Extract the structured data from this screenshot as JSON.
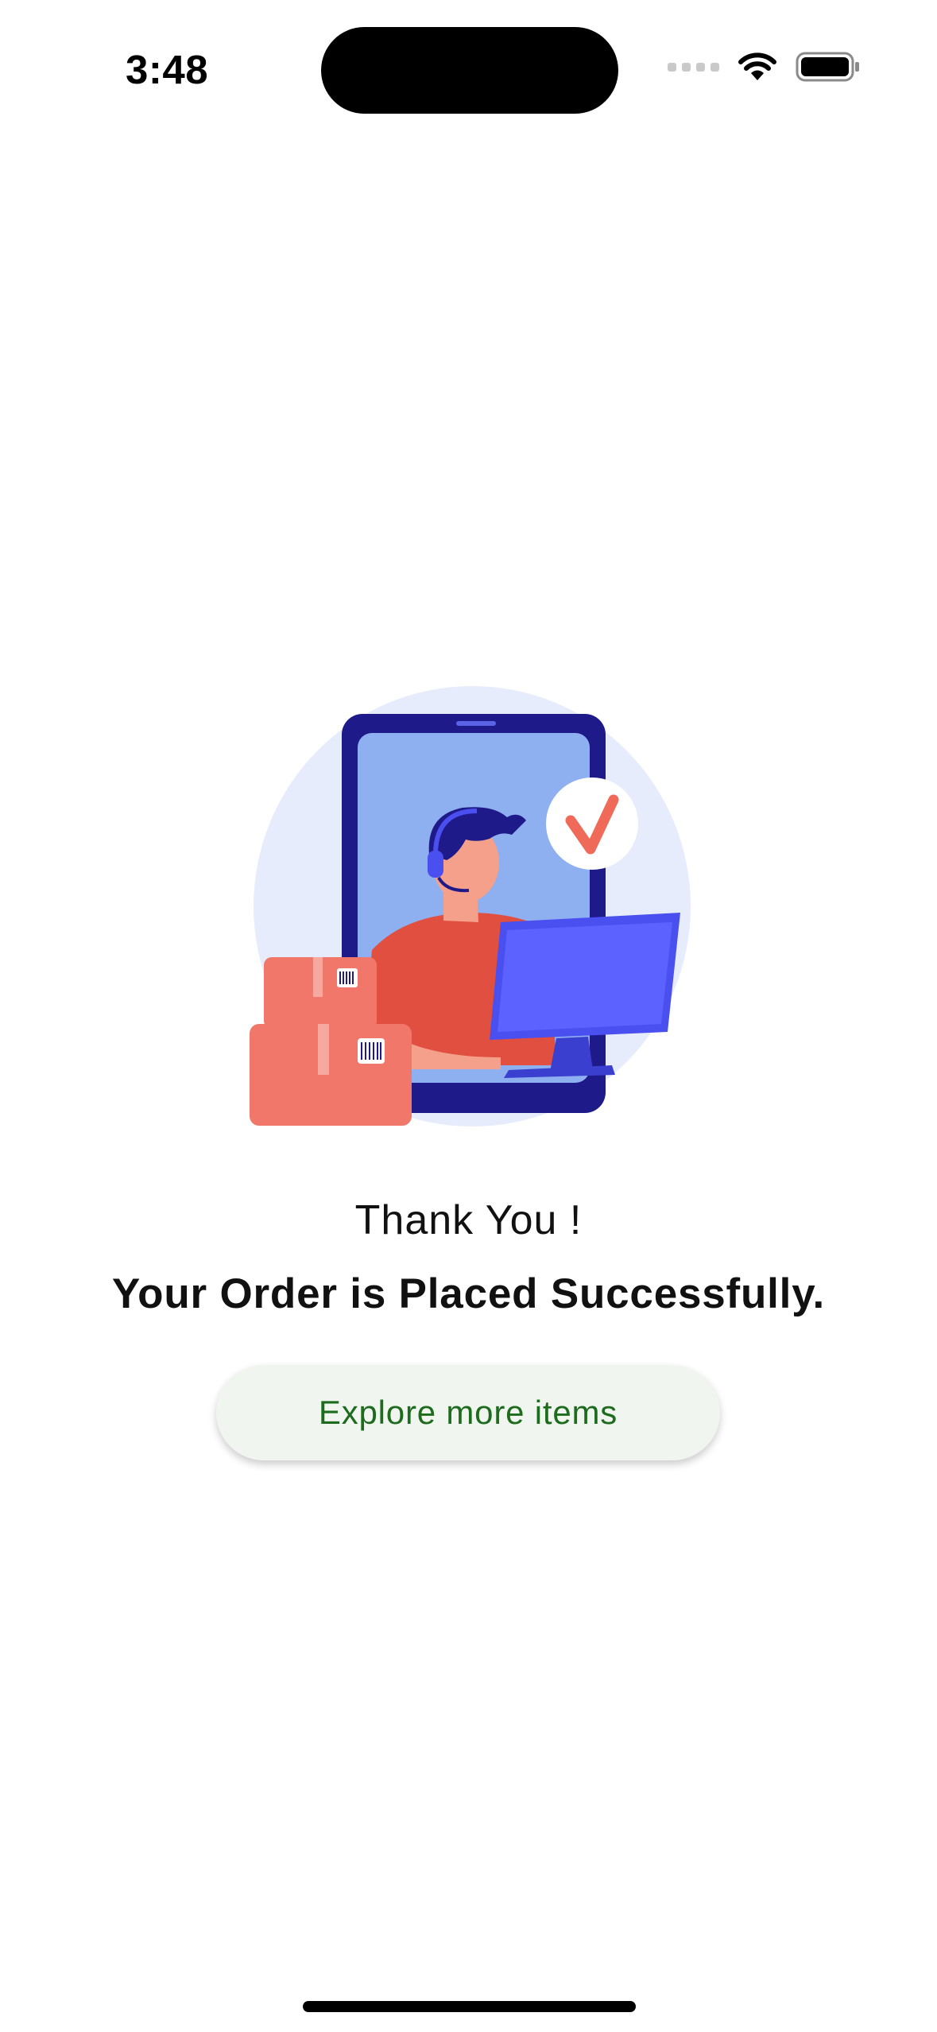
{
  "status_bar": {
    "time": "3:48"
  },
  "confirmation": {
    "thank_you": "Thank You !",
    "message": "Your Order is Placed Successfully.",
    "explore_button": "Explore more items"
  },
  "colors": {
    "button_text": "#1d6b1d",
    "button_bg": "#f1f5f0",
    "illustration_bg": "#e6ecfb",
    "phone_frame": "#1f1a8a",
    "phone_screen": "#8fb0f0",
    "accent_red": "#f06a5a",
    "monitor_blue": "#4a50f0"
  },
  "icons": {
    "signal": "signal-dots-icon",
    "wifi": "wifi-icon",
    "battery": "battery-icon",
    "check": "check-icon"
  }
}
